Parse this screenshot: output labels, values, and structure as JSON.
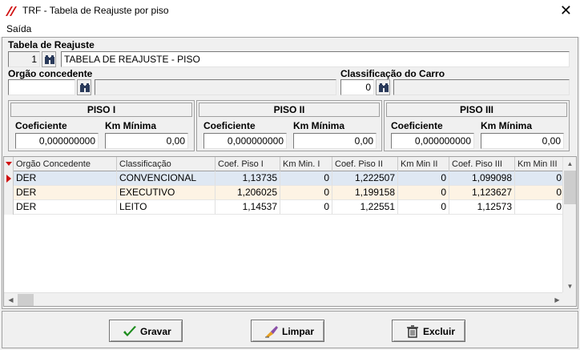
{
  "window": {
    "title": "TRF - Tabela de Reajuste por piso"
  },
  "menu": {
    "items": [
      {
        "label": "Saída"
      }
    ]
  },
  "tabela_reajuste": {
    "label": "Tabela de Reajuste",
    "code": "1",
    "description": "TABELA DE REAJUSTE - PISO"
  },
  "orgao": {
    "label": "Orgão concedente",
    "code": "",
    "description": ""
  },
  "classificacao": {
    "label": "Classificação do Carro",
    "code": "0",
    "description": ""
  },
  "pisos": [
    {
      "title": "PISO I",
      "coef_label": "Coeficiente",
      "km_label": "Km Mínima",
      "coef": "0,000000000",
      "km": "0,00"
    },
    {
      "title": "PISO II",
      "coef_label": "Coeficiente",
      "km_label": "Km Mínima",
      "coef": "0,000000000",
      "km": "0,00"
    },
    {
      "title": "PISO III",
      "coef_label": "Coeficiente",
      "km_label": "Km Mínima",
      "coef": "0,000000000",
      "km": "0,00"
    }
  ],
  "grid": {
    "columns": [
      "Orgão Concedente",
      "Classificação",
      "Coef. Piso I",
      "Km Min. I",
      "Coef. Piso II",
      "Km Min II",
      "Coef. Piso III",
      "Km Min III"
    ],
    "rows": [
      [
        "DER",
        "CONVENCIONAL",
        "1,13735",
        "0",
        "1,222507",
        "0",
        "1,099098",
        "0"
      ],
      [
        "DER",
        "EXECUTIVO",
        "1,206025",
        "0",
        "1,199158",
        "0",
        "1,123627",
        "0"
      ],
      [
        "DER",
        "LEITO",
        "1,14537",
        "0",
        "1,22551",
        "0",
        "1,12573",
        "0"
      ]
    ]
  },
  "buttons": {
    "gravar": "Gravar",
    "limpar": "Limpar",
    "excluir": "Excluir"
  },
  "colors": {
    "selected_row": "#dfe8f3",
    "alt_row": "#fdf3e4",
    "accent_red": "#d01010"
  }
}
